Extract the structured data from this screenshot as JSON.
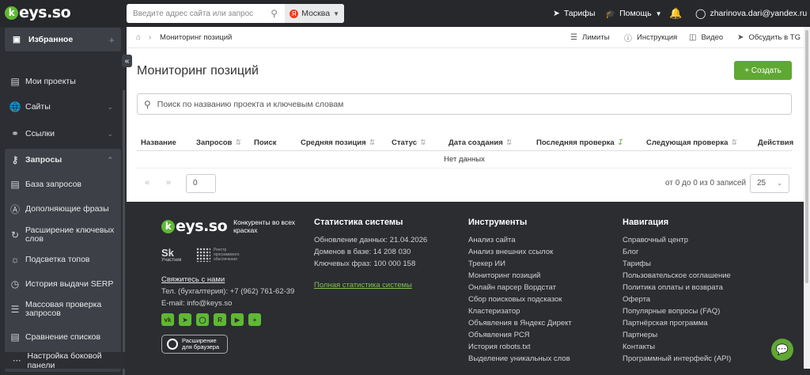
{
  "topbar": {
    "logo_letter": "k",
    "logo_text": "eys.so",
    "search_placeholder": "Введите адрес сайта или запрос",
    "region_badge": "Я",
    "region": "Москва",
    "tariffs": "Тарифы",
    "help": "Помощь",
    "user": "zharinova.dari@yandex.ru"
  },
  "sidebar": {
    "favorites": "Избранное",
    "items": [
      "Мои проекты",
      "Сайты",
      "Ссылки"
    ],
    "group_title": "Запросы",
    "group_items": [
      "База запросов",
      "Дополняющие фразы",
      "Расширение ключевых слов",
      "Подсветка топов",
      "История выдачи SERP",
      "Массовая проверка запросов",
      "Сравнение списков"
    ],
    "bottom": "Настройка боковой панели"
  },
  "breadcrumbs": {
    "current": "Мониторинг позиций"
  },
  "top_links": [
    "Лимиты",
    "Инструкция",
    "Видео",
    "Обсудить в TG"
  ],
  "page": {
    "title": "Мониторинг позиций",
    "create_button": "+ Создать",
    "search_placeholder": "Поиск по названию проекта и ключевым словам"
  },
  "table": {
    "columns": [
      "Название",
      "Запросов",
      "Поиск",
      "Средняя позиция",
      "Статус",
      "Дата создания",
      "Последняя проверка",
      "Следующая проверка",
      "Действия"
    ],
    "empty": "Нет данных"
  },
  "pager": {
    "page": "0",
    "info": "от 0 до 0 из 0 записей",
    "per_page": "25"
  },
  "footer": {
    "logo_letter": "k",
    "logo_text": "eys.so",
    "tagline": "Конкуренты во всех красках",
    "sk_mark": "Sk",
    "sk_text": "Участник",
    "registry_text": "Реестр программного обеспечения",
    "contact_link": "Свяжитесь с нами",
    "phone": "Тел. (бухгалтерия): +7 (962) 761-62-39",
    "email": "E-mail: info@keys.so",
    "extension": "Расширение для браузера",
    "stats": {
      "title": "Статистика системы",
      "lines": [
        "Обновление данных: 21.04.2026",
        "Доменов в базе: 14 208 030",
        "Ключевых фраз: 100 000 158"
      ],
      "link": "Полная статистика системы"
    },
    "tools": {
      "title": "Инструменты",
      "items": [
        "Анализ сайта",
        "Анализ внешних ссылок",
        "Трекер ИИ",
        "Мониторинг позиций",
        "Онлайн парсер Вордстат",
        "Сбор поисковых подсказок",
        "Кластеризатор",
        "Объявления в Яндекс Директ",
        "Объявления РСЯ",
        "История robots.txt",
        "Выделение уникальных слов"
      ]
    },
    "nav": {
      "title": "Навигация",
      "items": [
        "Справочный центр",
        "Блог",
        "Тарифы",
        "Пользовательское соглашение",
        "Политика оплаты и возврата",
        "Оферта",
        "Популярные вопросы (FAQ)",
        "Партнёрская программа",
        "Партнеры",
        "Контакты",
        "Программный интерфейс (API)"
      ]
    }
  },
  "colors": {
    "accent": "#5fa832",
    "dark": "#2b2d31"
  }
}
